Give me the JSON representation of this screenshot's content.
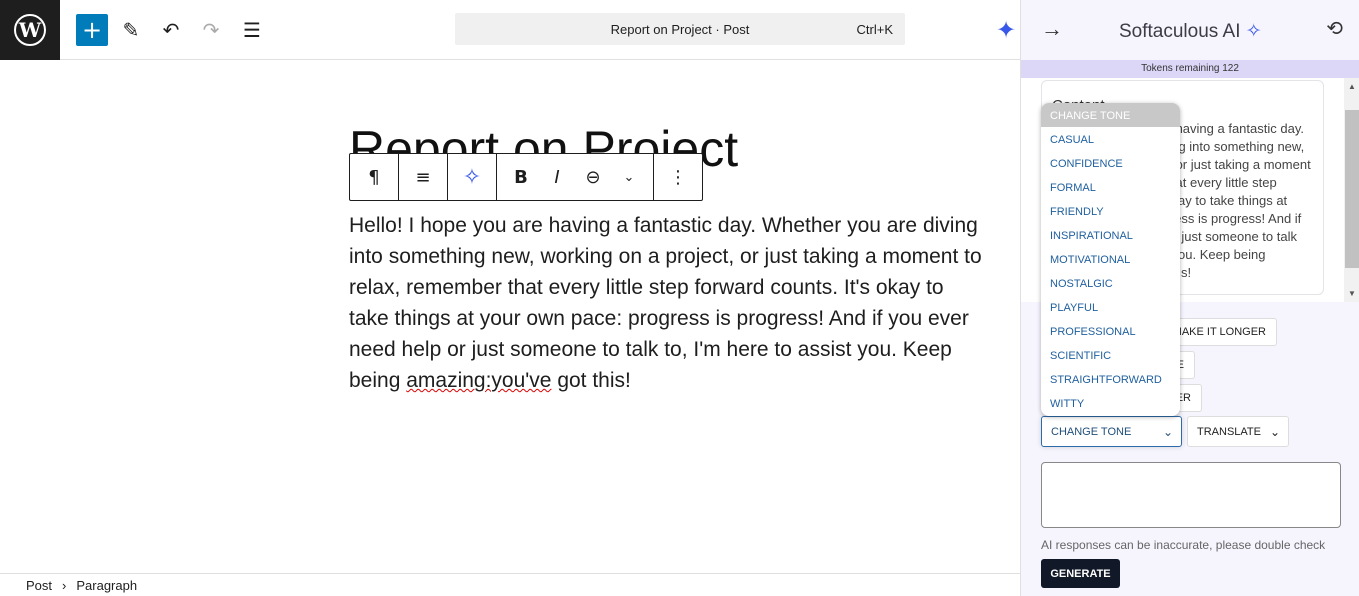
{
  "topbar": {
    "command_title": "Report on Project · Post",
    "shortcut": "Ctrl+K",
    "icons": [
      "wordpress-logo",
      "plus-icon",
      "pencil-icon",
      "undo-icon",
      "redo-icon",
      "list-view-icon",
      "sparkle-icon"
    ]
  },
  "editor": {
    "title": "Report on Project",
    "paragraph_before": "Hello! I hope you are having a fantastic day. Whether you are diving into something new, working on a project, or just taking a moment to relax, remember that every little step forward counts. It's okay to take things at your own pace: progress is progress! And if you ever need help or just someone to talk to, I'm here to assist you. Keep being ",
    "paragraph_misspelled": "amazing:you've",
    "paragraph_after": " got this!"
  },
  "block_toolbar": {
    "icons": [
      "paragraph-icon",
      "align-icon",
      "ai-sparkle-icon",
      "bold-icon",
      "italic-icon",
      "link-icon",
      "chevron-down-icon",
      "more-options-icon"
    ],
    "bold": "B",
    "italic": "I"
  },
  "footer": {
    "crumbs": [
      "Post",
      "Paragraph"
    ]
  },
  "panel": {
    "title": "Softaculous AI",
    "tokens": "Tokens remaining 122",
    "content_heading": "Content",
    "content_text": "Hello! I hope you are having a fantastic day. Whether you are diving into something new, working on a project, or just taking a moment to relax, remember that every little step forward counts. It's okay to take things at your own pace: progress is progress! And if you ever need help or just someone to talk to, I'm here to assist you. Keep being amazing:you've got this!",
    "buttons": [
      "MAKE IT LONGER",
      "E",
      "ER"
    ],
    "change_tone": "CHANGE TONE",
    "translate": "TRANSLATE",
    "note": "AI responses can be inaccurate, please double check",
    "generate": "GENERATE",
    "accent": "#3858e9"
  },
  "tone_dropdown": {
    "header": "CHANGE TONE",
    "options": [
      "CASUAL",
      "CONFIDENCE",
      "FORMAL",
      "FRIENDLY",
      "INSPIRATIONAL",
      "MOTIVATIONAL",
      "NOSTALGIC",
      "PLAYFUL",
      "PROFESSIONAL",
      "SCIENTIFIC",
      "STRAIGHTFORWARD",
      "WITTY"
    ]
  }
}
